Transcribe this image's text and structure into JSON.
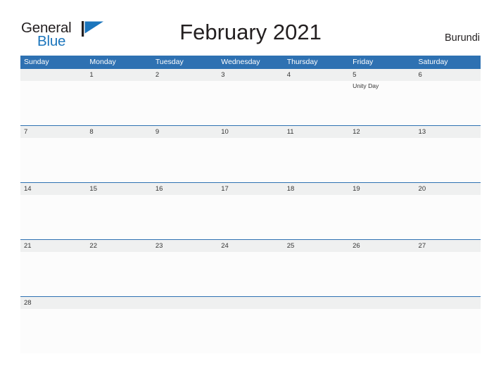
{
  "brand": {
    "name_part1": "General",
    "name_part2": "Blue",
    "mark": "triangle-flag-icon",
    "accent_color": "#1b75bc"
  },
  "header": {
    "title": "February 2021",
    "country": "Burundi"
  },
  "theme": {
    "header_blue": "#2e71b2",
    "date_strip_gray": "#eff0f0",
    "cell_white": "#fcfcfc",
    "text_dark": "#231f20"
  },
  "calendar": {
    "month": "February",
    "year": "2021",
    "weekdays": [
      "Sunday",
      "Monday",
      "Tuesday",
      "Wednesday",
      "Thursday",
      "Friday",
      "Saturday"
    ],
    "weeks": [
      {
        "days": [
          {
            "date": "",
            "events": []
          },
          {
            "date": "1",
            "events": []
          },
          {
            "date": "2",
            "events": []
          },
          {
            "date": "3",
            "events": []
          },
          {
            "date": "4",
            "events": []
          },
          {
            "date": "5",
            "events": [
              "Unity Day"
            ]
          },
          {
            "date": "6",
            "events": []
          }
        ]
      },
      {
        "days": [
          {
            "date": "7",
            "events": []
          },
          {
            "date": "8",
            "events": []
          },
          {
            "date": "9",
            "events": []
          },
          {
            "date": "10",
            "events": []
          },
          {
            "date": "11",
            "events": []
          },
          {
            "date": "12",
            "events": []
          },
          {
            "date": "13",
            "events": []
          }
        ]
      },
      {
        "days": [
          {
            "date": "14",
            "events": []
          },
          {
            "date": "15",
            "events": []
          },
          {
            "date": "16",
            "events": []
          },
          {
            "date": "17",
            "events": []
          },
          {
            "date": "18",
            "events": []
          },
          {
            "date": "19",
            "events": []
          },
          {
            "date": "20",
            "events": []
          }
        ]
      },
      {
        "days": [
          {
            "date": "21",
            "events": []
          },
          {
            "date": "22",
            "events": []
          },
          {
            "date": "23",
            "events": []
          },
          {
            "date": "24",
            "events": []
          },
          {
            "date": "25",
            "events": []
          },
          {
            "date": "26",
            "events": []
          },
          {
            "date": "27",
            "events": []
          }
        ]
      },
      {
        "days": [
          {
            "date": "28",
            "events": []
          },
          {
            "date": "",
            "events": []
          },
          {
            "date": "",
            "events": []
          },
          {
            "date": "",
            "events": []
          },
          {
            "date": "",
            "events": []
          },
          {
            "date": "",
            "events": []
          },
          {
            "date": "",
            "events": []
          }
        ]
      }
    ]
  }
}
